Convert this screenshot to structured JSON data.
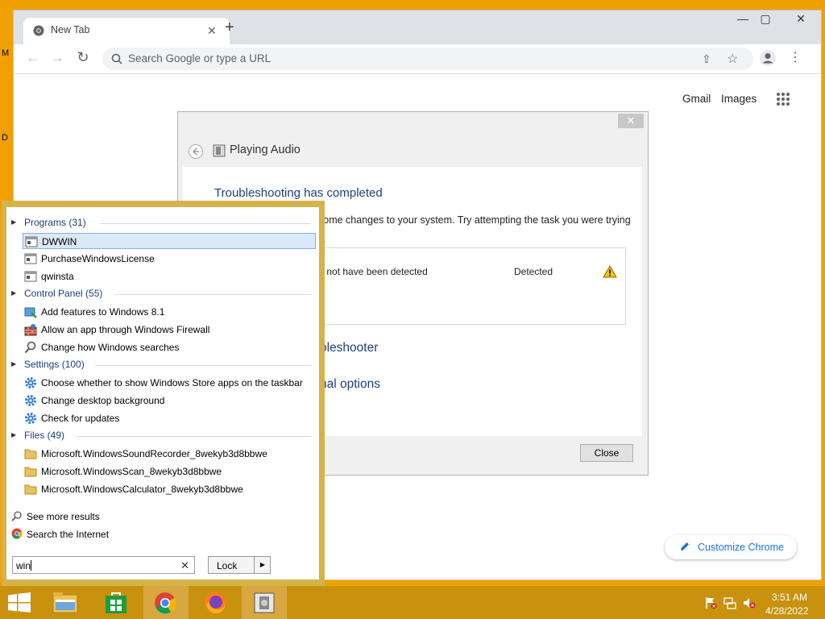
{
  "desktop": {
    "edge_text_1": "M",
    "edge_text_2": "D"
  },
  "browser": {
    "tab_title": "New Tab",
    "omnibox_placeholder": "Search Google or type a URL",
    "gmail": "Gmail",
    "images": "Images",
    "customize": "Customize Chrome"
  },
  "troubleshooter": {
    "title": "Playing Audio",
    "heading": "Troubleshooting has completed",
    "description": "some changes to your system. Try attempting the task you were trying",
    "problem_text": "ht not have been detected",
    "problem_status": "Detected",
    "link1": "oleshooter",
    "link2": "nal options",
    "close_button": "Close",
    "close_x": "✕"
  },
  "start_menu": {
    "categories": [
      {
        "label": "Programs (31)"
      },
      {
        "label": "Control Panel (55)"
      },
      {
        "label": "Settings (100)"
      },
      {
        "label": "Files (49)"
      }
    ],
    "programs": [
      "DWWIN",
      "PurchaseWindowsLicense",
      "qwinsta"
    ],
    "control_panel": [
      "Add features to Windows 8.1",
      "Allow an app through Windows Firewall",
      "Change how Windows searches"
    ],
    "settings": [
      "Choose whether to show Windows Store apps on the taskbar",
      "Change desktop background",
      "Check for updates"
    ],
    "files": [
      "Microsoft.WindowsSoundRecorder_8wekyb3d8bbwe",
      "Microsoft.WindowsScan_8wekyb3d8bbwe",
      "Microsoft.WindowsCalculator_8wekyb3d8bbwe"
    ],
    "see_more": "See more results",
    "search_internet": "Search the Internet",
    "search_value": "win",
    "lock_label": "Lock"
  },
  "taskbar": {
    "time": "3:51 AM",
    "date": "4/28/2022"
  },
  "colors": {
    "desktop": "#f0a000",
    "taskbar": "#c8920e",
    "start_border": "#d4b44a",
    "link_blue": "#1e3e7a",
    "chrome_blue": "#1a73e8"
  }
}
